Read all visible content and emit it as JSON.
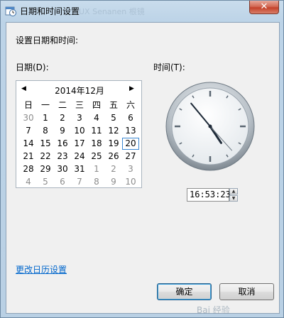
{
  "window": {
    "title": "日期和时间设置",
    "ghost_text": "UX    Senanen    根镜",
    "close_label": "✕"
  },
  "dialog": {
    "instruction": "设置日期和时间:",
    "date_label": "日期(D):",
    "time_label": "时间(T):",
    "change_calendar_link": "更改日历设置",
    "ok_label": "确定",
    "cancel_label": "取消",
    "watermark": "Bai 经验"
  },
  "calendar": {
    "prev_label": "◀",
    "next_label": "▶",
    "month_title": "2014年12月",
    "weekdays": [
      "日",
      "一",
      "二",
      "三",
      "四",
      "五",
      "六"
    ],
    "weeks": [
      [
        "30",
        "1",
        "2",
        "3",
        "4",
        "5",
        "6"
      ],
      [
        "7",
        "8",
        "9",
        "10",
        "11",
        "12",
        "13"
      ],
      [
        "14",
        "15",
        "16",
        "17",
        "18",
        "19",
        "20"
      ],
      [
        "21",
        "22",
        "23",
        "24",
        "25",
        "26",
        "27"
      ],
      [
        "28",
        "29",
        "30",
        "31",
        "1",
        "2",
        "3"
      ],
      [
        "4",
        "5",
        "6",
        "7",
        "8",
        "9",
        "10"
      ]
    ],
    "selected_day": "20"
  },
  "clock": {
    "hours": 16,
    "minutes": 53,
    "seconds": 23
  },
  "time": {
    "value": "16:53:23"
  },
  "colors": {
    "link": "#0066cc",
    "today_border": "#3a87d3",
    "close_button": "#c4422a"
  }
}
